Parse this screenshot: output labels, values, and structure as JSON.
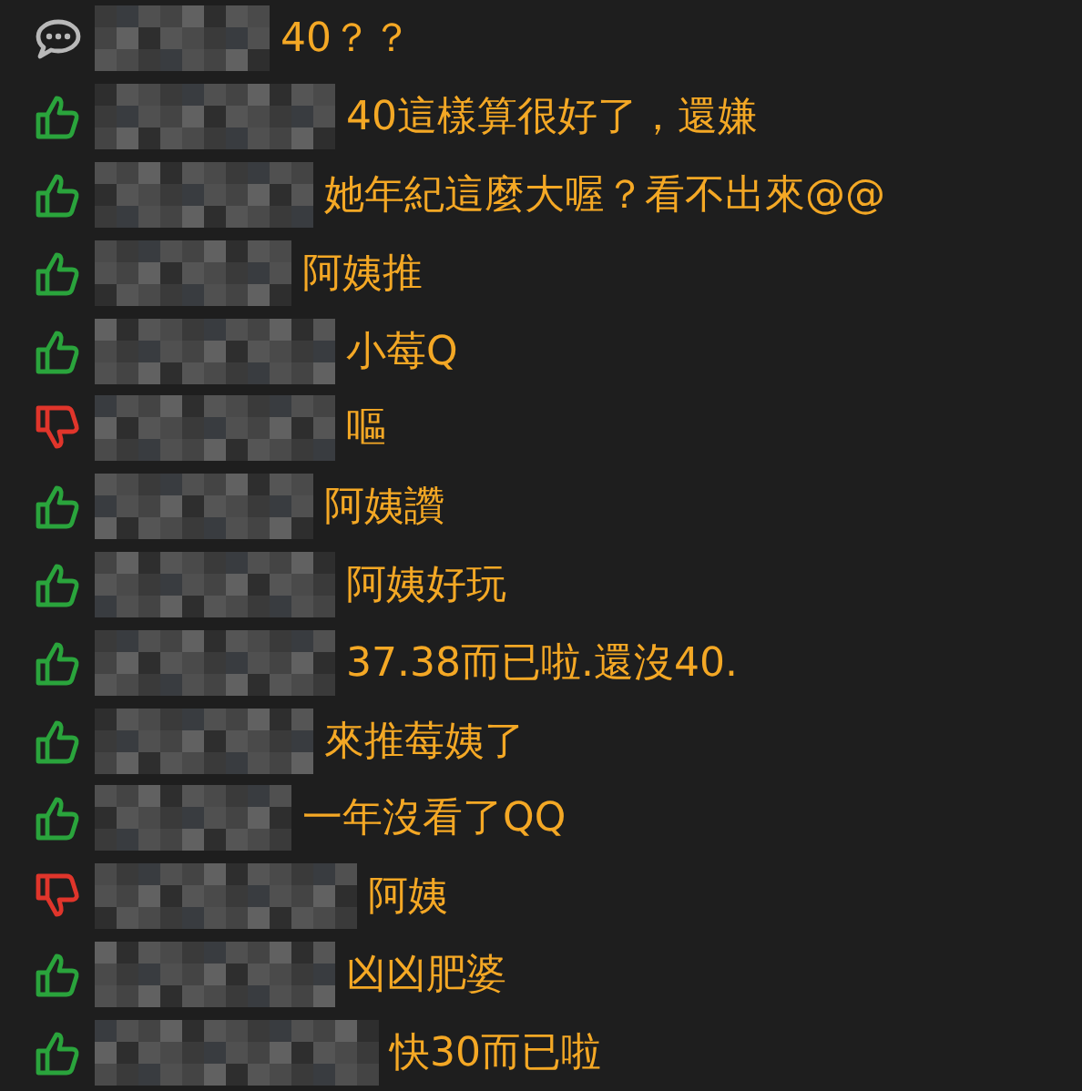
{
  "comments": [
    {
      "kind": "comment",
      "text": "40？？"
    },
    {
      "kind": "push",
      "text": "40這樣算很好了，還嫌"
    },
    {
      "kind": "push",
      "text": "她年紀這麼大喔？看不出來@@"
    },
    {
      "kind": "push",
      "text": "阿姨推"
    },
    {
      "kind": "push",
      "text": "小莓Q"
    },
    {
      "kind": "boo",
      "text": "嘔"
    },
    {
      "kind": "push",
      "text": "阿姨讚"
    },
    {
      "kind": "push",
      "text": "阿姨好玩"
    },
    {
      "kind": "push",
      "text": "37.38而已啦.還沒40."
    },
    {
      "kind": "push",
      "text": "來推莓姨了"
    },
    {
      "kind": "push",
      "text": "一年沒看了QQ"
    },
    {
      "kind": "boo",
      "text": "阿姨"
    },
    {
      "kind": "push",
      "text": "凶凶肥婆"
    },
    {
      "kind": "push",
      "text": "快30而已啦"
    }
  ]
}
